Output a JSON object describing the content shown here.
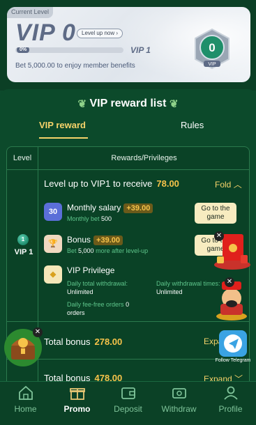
{
  "current_level_tag": "Current Level",
  "vip_level": "VIP 0",
  "level_up_link": "Level up now",
  "progress": {
    "percent_label": "0%",
    "value": 0
  },
  "next_level": "VIP 1",
  "bet_prefix": "Bet",
  "bet_amount": "5,000.00",
  "bet_suffix": "to enjoy member benefits",
  "badge_number": "0",
  "badge_label": "VIP",
  "section_title": "VIP reward list",
  "tabs": [
    "VIP reward",
    "Rules"
  ],
  "table": {
    "headers": [
      "Level",
      "Rewards/Privileges"
    ],
    "level_row": {
      "level_icon_number": "1",
      "level_name": "VIP 1",
      "title": "Level up to VIP1 to receive",
      "amount": "78.00",
      "toggle_label": "Fold",
      "rewards": [
        {
          "name": "Monthly salary",
          "value": "+39.00",
          "sub_label": "Monthly bet",
          "sub_value": "500",
          "button": "Go to the game",
          "icon_text": "30"
        },
        {
          "name": "Bonus",
          "value": "+39.00",
          "sub_label": "Bet",
          "sub_value": "5,000",
          "sub_suffix": "more after level-up",
          "button": "Go to the game"
        }
      ],
      "privilege": {
        "name": "VIP Privilege",
        "daily_total_label": "Daily total withdrawal:",
        "daily_total_value": "Unlimited",
        "daily_times_label": "Daily withdrawal times:",
        "daily_times_value": "Unlimited",
        "fee_free_label": "Daily fee-free orders",
        "fee_free_value": "0",
        "fee_free_unit": "orders"
      }
    },
    "total_rows": [
      {
        "label": "Total bonus",
        "amount": "278.00",
        "toggle": "Expand"
      },
      {
        "label": "Total bonus",
        "amount": "478.00",
        "toggle": "Expand"
      }
    ]
  },
  "floating": {
    "telegram_label": "Follow Telegram"
  },
  "nav": [
    {
      "label": "Home",
      "icon": "home-icon"
    },
    {
      "label": "Promo",
      "icon": "gift-icon"
    },
    {
      "label": "Deposit",
      "icon": "wallet-icon"
    },
    {
      "label": "Withdraw",
      "icon": "withdraw-icon"
    },
    {
      "label": "Profile",
      "icon": "profile-icon"
    }
  ],
  "colors": {
    "accent": "#f6d36a",
    "amount": "#f6c34a",
    "bg": "#0c4a2b",
    "muted_green": "#5ec58b"
  }
}
